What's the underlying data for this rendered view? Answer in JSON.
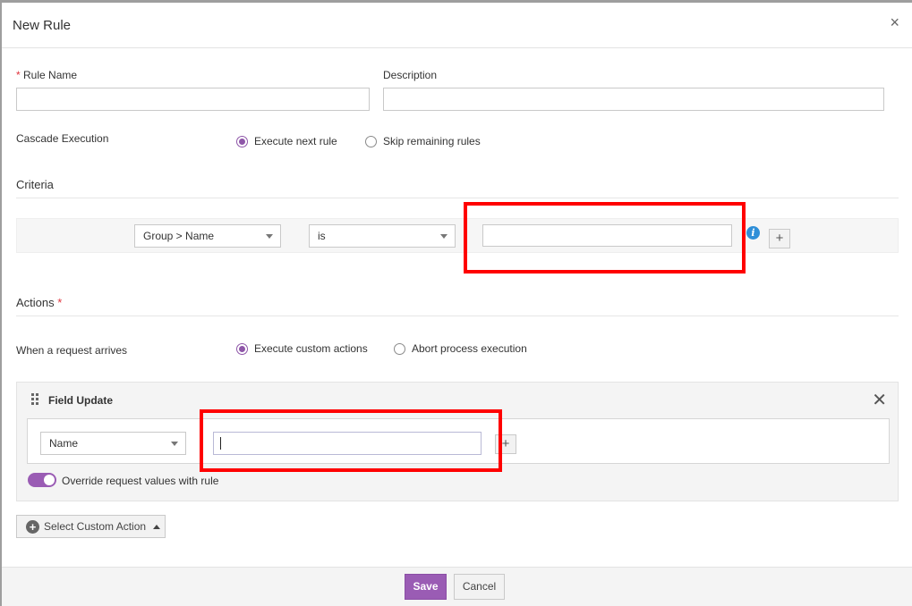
{
  "header": {
    "title": "New Rule",
    "close_glyph": "×"
  },
  "form": {
    "rule_name": {
      "label": "Rule Name",
      "required_mark": "*",
      "value": ""
    },
    "description": {
      "label": "Description",
      "value": ""
    },
    "cascade": {
      "label": "Cascade Execution",
      "options": [
        {
          "label": "Execute next rule",
          "checked": true
        },
        {
          "label": "Skip remaining rules",
          "checked": false
        }
      ]
    }
  },
  "criteria": {
    "title": "Criteria",
    "field_select": "Group > Name",
    "operator_select": "is",
    "value": "",
    "info_glyph": "i",
    "add_glyph": "+"
  },
  "actions": {
    "title": "Actions",
    "required_mark": "*",
    "when_label": "When a request arrives",
    "options": [
      {
        "label": "Execute custom actions",
        "checked": true
      },
      {
        "label": "Abort process execution",
        "checked": false
      }
    ],
    "field_update": {
      "title": "Field Update",
      "close_glyph": "✕",
      "field_select": "Name",
      "value": "",
      "add_glyph": "+",
      "override_label": "Override request values with rule",
      "override_on": true
    },
    "select_custom_action": {
      "label": "Select Custom Action",
      "icon": "circle-plus-icon"
    }
  },
  "footer": {
    "save_label": "Save",
    "cancel_label": "Cancel"
  },
  "colors": {
    "accent": "#9a5cb4",
    "highlight": "#ff0000",
    "info": "#2f8fd8",
    "required": "#e0343d"
  }
}
